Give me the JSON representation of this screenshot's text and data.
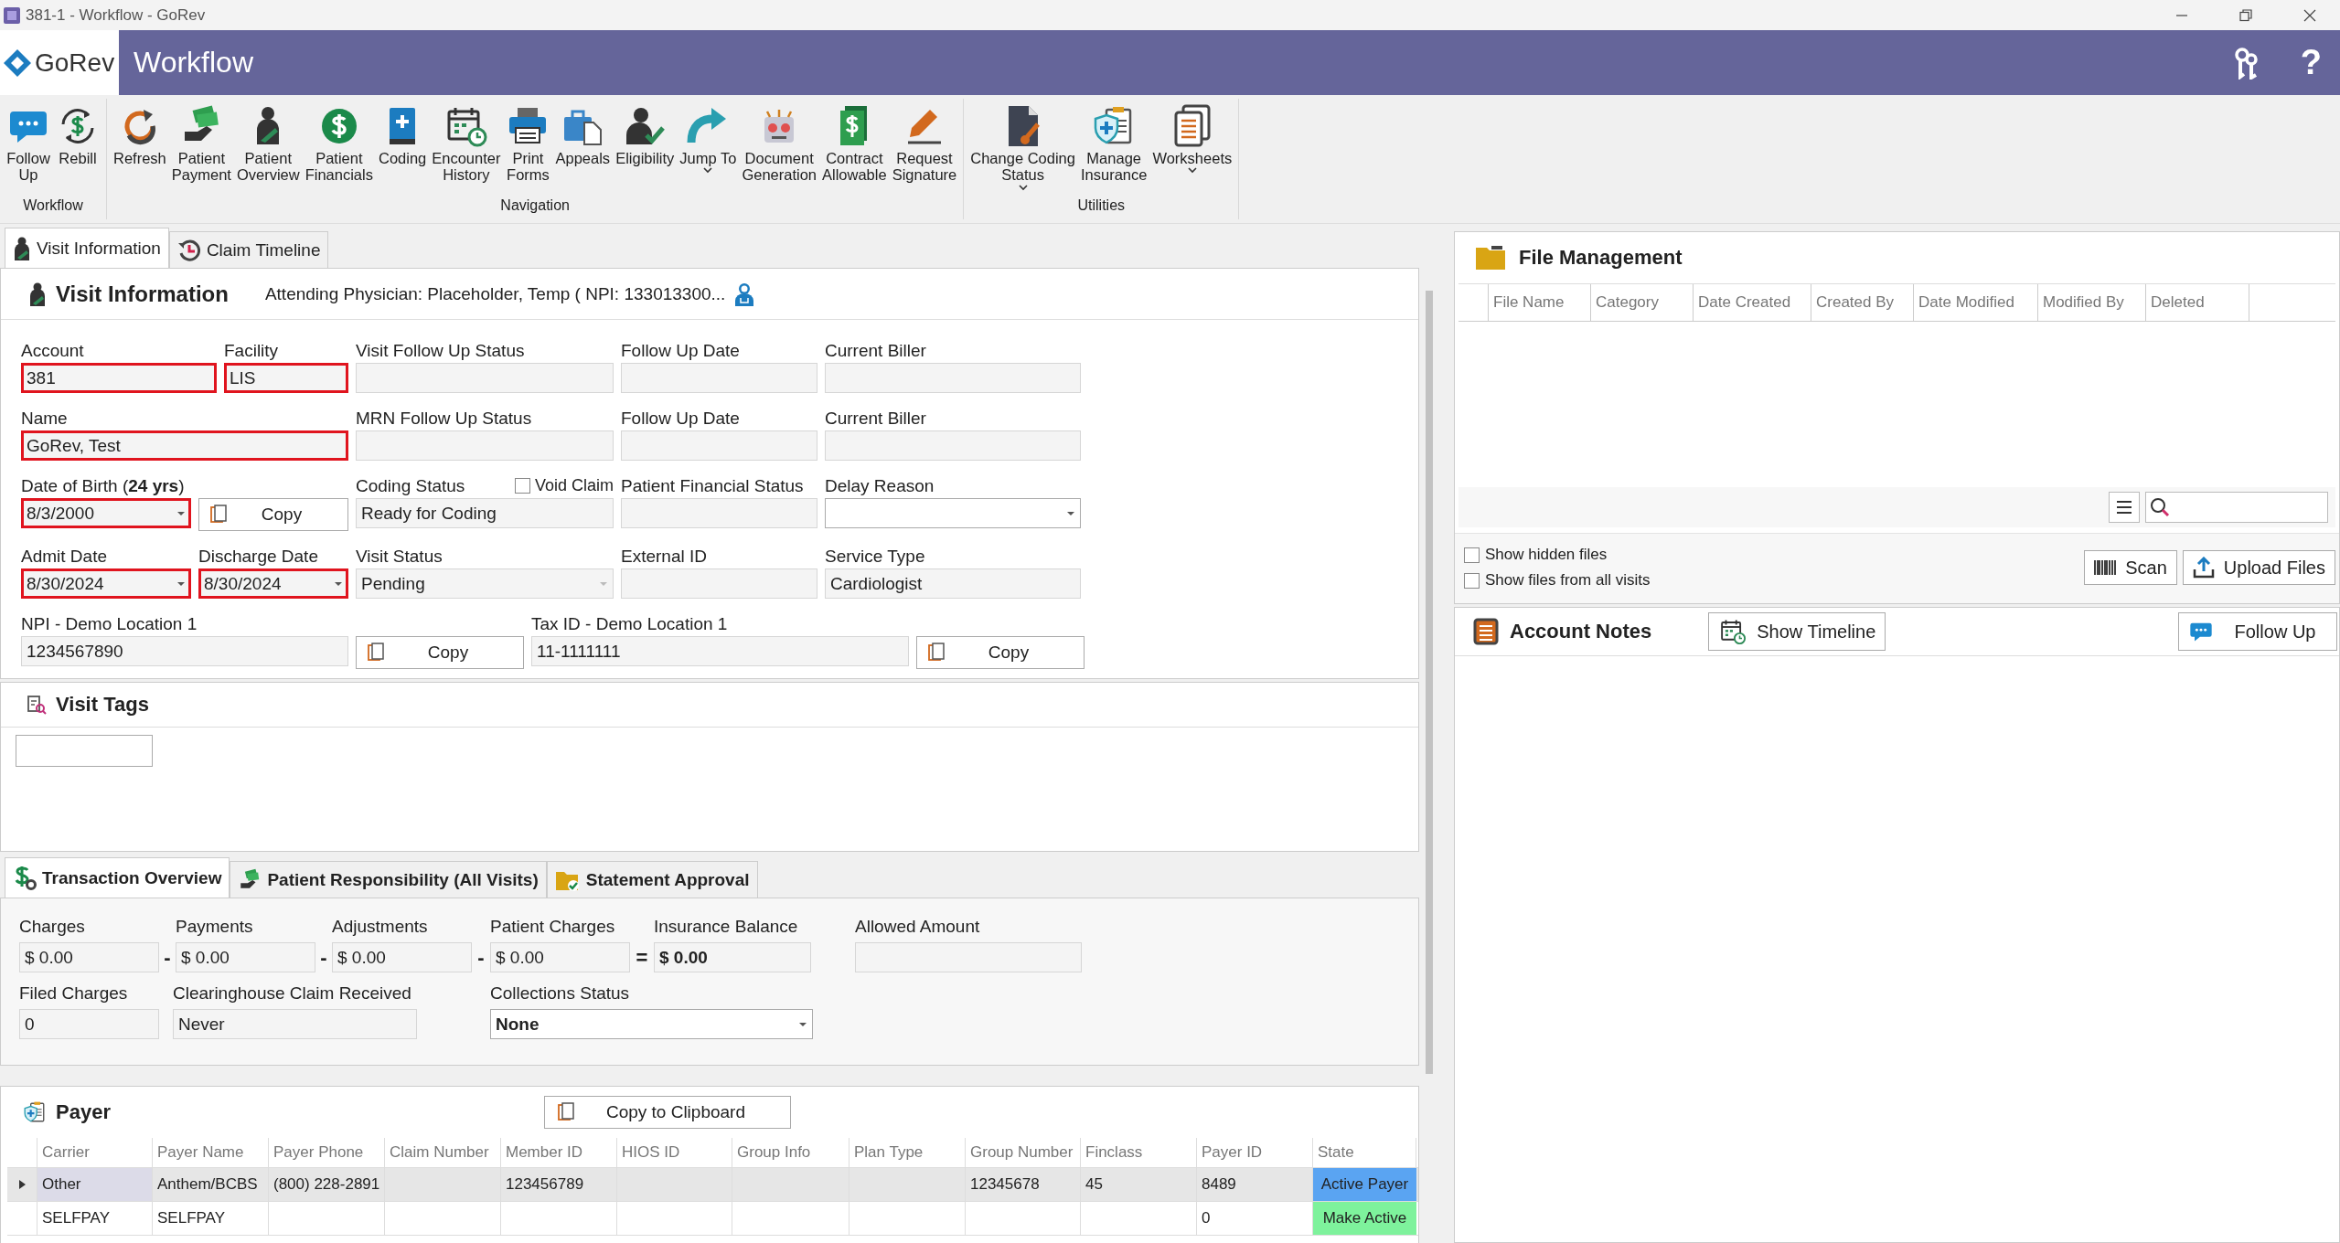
{
  "window": {
    "title": "381-1 - Workflow - GoRev"
  },
  "header": {
    "logo": "GoRev",
    "title": "Workflow",
    "help": "?"
  },
  "ribbon": {
    "groups": [
      {
        "label": "Workflow",
        "items": [
          {
            "lines": [
              "Follow",
              "Up"
            ],
            "has_menu": false
          },
          {
            "lines": [
              "Rebill"
            ],
            "has_menu": false
          }
        ]
      },
      {
        "label": "Navigation",
        "items": [
          {
            "lines": [
              "Refresh"
            ],
            "has_menu": false
          },
          {
            "lines": [
              "Patient",
              "Payment"
            ],
            "has_menu": false
          },
          {
            "lines": [
              "Patient",
              "Overview"
            ],
            "has_menu": false
          },
          {
            "lines": [
              "Patient",
              "Financials"
            ],
            "has_menu": false
          },
          {
            "lines": [
              "Coding"
            ],
            "has_menu": false
          },
          {
            "lines": [
              "Encounter",
              "History"
            ],
            "has_menu": false
          },
          {
            "lines": [
              "Print",
              "Forms"
            ],
            "has_menu": false
          },
          {
            "lines": [
              "Appeals"
            ],
            "has_menu": false
          },
          {
            "lines": [
              "Eligibility"
            ],
            "has_menu": false
          },
          {
            "lines": [
              "Jump To"
            ],
            "has_menu": true
          },
          {
            "lines": [
              "Document",
              "Generation"
            ],
            "has_menu": false
          },
          {
            "lines": [
              "Contract",
              "Allowable"
            ],
            "has_menu": false
          },
          {
            "lines": [
              "Request",
              "Signature"
            ],
            "has_menu": false
          }
        ]
      },
      {
        "label": "Utilities",
        "items": [
          {
            "lines": [
              "Change Coding",
              "Status"
            ],
            "has_menu": true
          },
          {
            "lines": [
              "Manage",
              "Insurance"
            ],
            "has_menu": false
          },
          {
            "lines": [
              "Worksheets"
            ],
            "has_menu": true
          }
        ]
      }
    ]
  },
  "tabs": [
    {
      "label": "Visit Information",
      "selected": true
    },
    {
      "label": "Claim Timeline",
      "selected": false
    }
  ],
  "visit_info": {
    "title": "Visit Information",
    "physician": "Attending Physician: Placeholder, Temp ( NPI: 133013300...",
    "fields": [
      {
        "kind": "text",
        "label": "Account",
        "value": "381",
        "highlighted": true
      },
      {
        "kind": "text",
        "label": "Facility",
        "value": "LIS",
        "highlighted": true
      },
      {
        "kind": "text",
        "label": "Visit Follow Up Status",
        "highlighted": false
      },
      {
        "kind": "text",
        "label": "Follow Up Date",
        "highlighted": false
      },
      {
        "kind": "text",
        "label": "Current Biller",
        "highlighted": false
      },
      {
        "kind": "text",
        "label": "Name",
        "value": "GoRev, Test",
        "highlighted": true
      },
      {
        "kind": "text",
        "label": "MRN Follow Up Status",
        "highlighted": false
      },
      {
        "kind": "text",
        "label": "Follow Up Date",
        "highlighted": false
      },
      {
        "kind": "text",
        "label": "Current Biller",
        "highlighted": false
      },
      {
        "kind": "dropdown",
        "label": "Date of Birth (**24 yrs**)",
        "value": "8/3/2000",
        "highlighted": true,
        "disabled": false
      },
      {
        "kind": "copy-button",
        "text": "Copy"
      },
      {
        "kind": "text",
        "label": "Coding Status",
        "value": "Ready for Coding",
        "highlighted": false,
        "checkbox": {
          "label": "Void Claim",
          "checked": false
        }
      },
      {
        "kind": "text",
        "label": "Patient Financial Status",
        "highlighted": false
      },
      {
        "kind": "dropdown",
        "label": "Delay Reason",
        "highlighted": false,
        "disabled": false
      },
      {
        "kind": "dropdown",
        "label": "Admit Date",
        "value": "8/30/2024",
        "highlighted": true,
        "disabled": false
      },
      {
        "kind": "dropdown",
        "label": "Discharge Date",
        "value": "8/30/2024",
        "highlighted": true,
        "disabled": false
      },
      {
        "kind": "dropdown",
        "label": "Visit Status",
        "value": "Pending",
        "highlighted": false,
        "disabled": true
      },
      {
        "kind": "text",
        "label": "External ID",
        "highlighted": false
      },
      {
        "kind": "text",
        "label": "Service Type",
        "value": "Cardiologist",
        "highlighted": false
      },
      {
        "kind": "text",
        "label": "NPI - Demo Location 1",
        "value": "1234567890",
        "highlighted": false
      },
      {
        "kind": "copy-button",
        "text": "Copy"
      },
      {
        "kind": "text",
        "label": "Tax ID - Demo Location 1",
        "value": "11-1111111",
        "highlighted": false
      },
      {
        "kind": "copy-button",
        "text": "Copy"
      }
    ]
  },
  "visit_tags": {
    "title": "Visit Tags"
  },
  "transaction": {
    "tabs": [
      {
        "label": "Transaction Overview",
        "selected": true
      },
      {
        "label": "Patient Responsibility (All Visits)",
        "selected": false
      },
      {
        "label": "Statement Approval",
        "selected": false
      }
    ],
    "fields": [
      {
        "kind": "field",
        "label": "Charges",
        "value": "$ 0.00"
      },
      {
        "kind": "field",
        "label": "Payments",
        "value": "$ 0.00",
        "operator": "-"
      },
      {
        "kind": "field",
        "label": "Adjustments",
        "value": "$ 0.00",
        "operator": "-"
      },
      {
        "kind": "field",
        "label": "Patient Charges",
        "value": "$ 0.00",
        "operator": "-"
      },
      {
        "kind": "total",
        "label": "Insurance Balance",
        "value": "$ 0.00",
        "operator": "="
      },
      {
        "kind": "field",
        "label": "Allowed Amount"
      },
      {
        "kind": "field",
        "label": "Filed Charges",
        "value": "0"
      },
      {
        "kind": "field",
        "label": "Clearinghouse Claim Received",
        "value": "Never"
      },
      {
        "kind": "dropdown",
        "label": "Collections Status",
        "value": "None"
      }
    ]
  },
  "payer": {
    "title": "Payer",
    "copy_button": "Copy to Clipboard",
    "columns": [
      "Carrier",
      "Payer Name",
      "Payer Phone",
      "Claim Number",
      "Member ID",
      "HIOS ID",
      "Group Info",
      "Plan Type",
      "Group Number",
      "Finclass",
      "Payer ID",
      "State"
    ],
    "rows": [
      {
        "selected": true,
        "active": true,
        "cells": [
          "Other",
          "Anthem/BCBS",
          "(800) 228-2891",
          null,
          "123456789",
          null,
          null,
          null,
          "12345678",
          "45",
          "8489"
        ],
        "state": "Active Payer"
      },
      {
        "selected": false,
        "active": false,
        "cells": [
          "SELFPAY",
          "SELFPAY",
          null,
          null,
          null,
          null,
          null,
          null,
          null,
          null,
          "0"
        ],
        "state": "Make Active"
      }
    ]
  },
  "file_management": {
    "title": "File Management",
    "columns": [
      "File Name",
      "Category",
      "Date Created",
      "Created By",
      "Date Modified",
      "Modified By",
      "Deleted"
    ],
    "checkboxes": [
      {
        "label": "Show hidden files",
        "checked": false
      },
      {
        "label": "Show files from all visits",
        "checked": false
      }
    ],
    "buttons": [
      "Scan",
      "Upload Files"
    ]
  },
  "account_notes": {
    "title": "Account Notes",
    "timeline_button": "Show Timeline",
    "follow_up_button": "Follow Up"
  }
}
